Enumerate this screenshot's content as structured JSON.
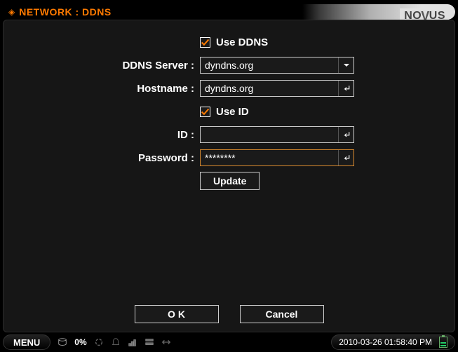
{
  "titlebar": {
    "breadcrumb": "NETWORK : DDNS",
    "brand": "NOVUS"
  },
  "form": {
    "use_ddns": {
      "label": "Use DDNS",
      "checked": true
    },
    "ddns_server": {
      "label": "DDNS Server :",
      "value": "dyndns.org"
    },
    "hostname": {
      "label": "Hostname :",
      "value": "dyndns.org"
    },
    "use_id": {
      "label": "Use ID",
      "checked": true
    },
    "id": {
      "label": "ID :",
      "value": ""
    },
    "password": {
      "label": "Password :",
      "value": "********"
    },
    "update_btn": "Update"
  },
  "footer": {
    "ok": "O K",
    "cancel": "Cancel"
  },
  "statusbar": {
    "menu": "MENU",
    "disk_percent": "0%",
    "datetime": "2010-03-26 01:58:40 PM"
  }
}
